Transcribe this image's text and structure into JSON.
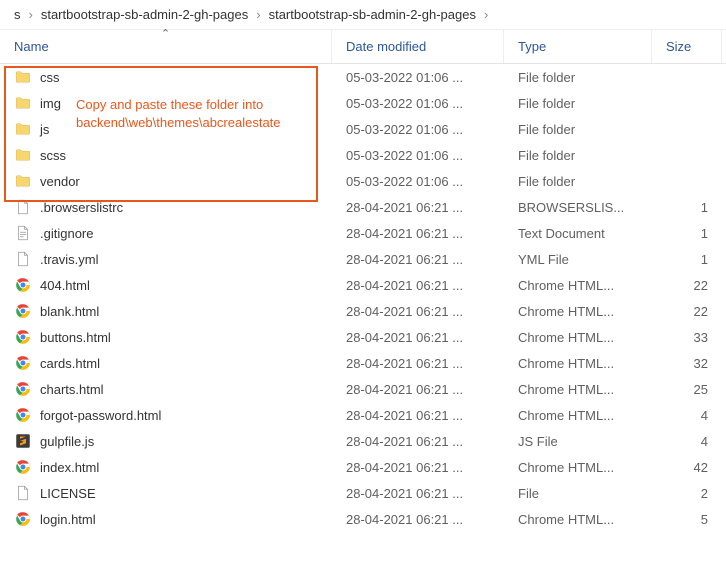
{
  "breadcrumb": {
    "seg0": "s",
    "seg1": "startbootstrap-sb-admin-2-gh-pages",
    "seg2": "startbootstrap-sb-admin-2-gh-pages"
  },
  "headers": {
    "name": "Name",
    "date": "Date modified",
    "type": "Type",
    "size": "Size"
  },
  "annotation": {
    "line1": "Copy and paste these folder into",
    "line2": "backend\\web\\themes\\abcrealestate"
  },
  "rows": [
    {
      "name": "css",
      "date": "05-03-2022 01:06 ...",
      "type": "File folder",
      "size": "",
      "icon": "folder"
    },
    {
      "name": "img",
      "date": "05-03-2022 01:06 ...",
      "type": "File folder",
      "size": "",
      "icon": "folder"
    },
    {
      "name": "js",
      "date": "05-03-2022 01:06 ...",
      "type": "File folder",
      "size": "",
      "icon": "folder"
    },
    {
      "name": "scss",
      "date": "05-03-2022 01:06 ...",
      "type": "File folder",
      "size": "",
      "icon": "folder"
    },
    {
      "name": "vendor",
      "date": "05-03-2022 01:06 ...",
      "type": "File folder",
      "size": "",
      "icon": "folder"
    },
    {
      "name": ".browserslistrc",
      "date": "28-04-2021 06:21 ...",
      "type": "BROWSERSLIS...",
      "size": "1",
      "icon": "file"
    },
    {
      "name": ".gitignore",
      "date": "28-04-2021 06:21 ...",
      "type": "Text Document",
      "size": "1",
      "icon": "textfile"
    },
    {
      "name": ".travis.yml",
      "date": "28-04-2021 06:21 ...",
      "type": "YML File",
      "size": "1",
      "icon": "file"
    },
    {
      "name": "404.html",
      "date": "28-04-2021 06:21 ...",
      "type": "Chrome HTML...",
      "size": "22",
      "icon": "chrome"
    },
    {
      "name": "blank.html",
      "date": "28-04-2021 06:21 ...",
      "type": "Chrome HTML...",
      "size": "22",
      "icon": "chrome"
    },
    {
      "name": "buttons.html",
      "date": "28-04-2021 06:21 ...",
      "type": "Chrome HTML...",
      "size": "33",
      "icon": "chrome"
    },
    {
      "name": "cards.html",
      "date": "28-04-2021 06:21 ...",
      "type": "Chrome HTML...",
      "size": "32",
      "icon": "chrome"
    },
    {
      "name": "charts.html",
      "date": "28-04-2021 06:21 ...",
      "type": "Chrome HTML...",
      "size": "25",
      "icon": "chrome"
    },
    {
      "name": "forgot-password.html",
      "date": "28-04-2021 06:21 ...",
      "type": "Chrome HTML...",
      "size": "4",
      "icon": "chrome"
    },
    {
      "name": "gulpfile.js",
      "date": "28-04-2021 06:21 ...",
      "type": "JS File",
      "size": "4",
      "icon": "sublime"
    },
    {
      "name": "index.html",
      "date": "28-04-2021 06:21 ...",
      "type": "Chrome HTML...",
      "size": "42",
      "icon": "chrome"
    },
    {
      "name": "LICENSE",
      "date": "28-04-2021 06:21 ...",
      "type": "File",
      "size": "2",
      "icon": "file"
    },
    {
      "name": "login.html",
      "date": "28-04-2021 06:21 ...",
      "type": "Chrome HTML...",
      "size": "5",
      "icon": "chrome"
    }
  ]
}
